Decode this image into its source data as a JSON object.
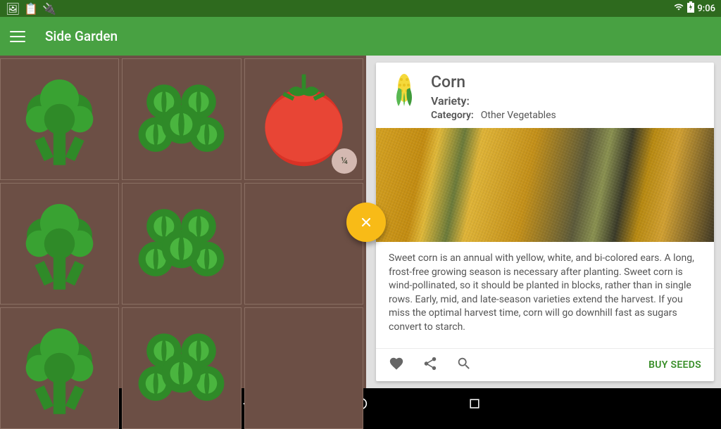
{
  "status": {
    "icons": [
      "image-icon",
      "clipboard-icon",
      "plug-icon"
    ],
    "right_icons": [
      "wifi-icon",
      "battery-icon"
    ],
    "time": "9:06"
  },
  "header": {
    "title": "Side Garden"
  },
  "garden": {
    "fab_icon": "close-icon",
    "plots": [
      {
        "plant": "broccoli"
      },
      {
        "plant": "brussels-sprouts"
      },
      {
        "plant": "tomato",
        "badge": "¼"
      },
      {
        "plant": "broccoli"
      },
      {
        "plant": "brussels-sprouts"
      },
      {
        "plant": null
      },
      {
        "plant": "broccoli"
      },
      {
        "plant": "brussels-sprouts"
      },
      {
        "plant": null
      }
    ]
  },
  "detail": {
    "icon": "corn-icon",
    "title": "Corn",
    "variety_label": "Variety:",
    "variety_value": "",
    "category_label": "Category:",
    "category_value": "Other Vegetables",
    "description": "Sweet corn is an annual with yellow, white, and bi-colored ears. A long, frost-free growing season is necessary after planting. Sweet corn is wind-pollinated, so it should be planted in blocks, rather than in single rows. Early, mid, and late-season varieties extend the harvest. If you miss the optimal harvest time, corn will go downhill fast as sugars convert to starch.",
    "actions": {
      "favorite": "favorite-icon",
      "share": "share-icon",
      "search": "search-icon",
      "buy_label": "BUY SEEDS"
    }
  },
  "nav": {
    "back": "back-icon",
    "home": "home-icon",
    "recent": "recent-icon"
  }
}
